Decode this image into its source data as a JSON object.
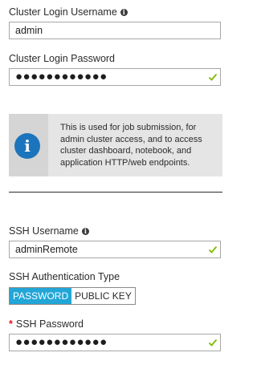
{
  "cluster_login_username": {
    "label": "Cluster Login Username",
    "value": "admin"
  },
  "cluster_login_password": {
    "label": "Cluster Login Password",
    "value": "●●●●●●●●●●●●"
  },
  "info_box": {
    "text": "This is used for job submission, for admin cluster access, and to access cluster dashboard, notebook, and application HTTP/web endpoints."
  },
  "ssh_username": {
    "label": "SSH Username",
    "value": "adminRemote"
  },
  "ssh_auth_type": {
    "label": "SSH Authentication Type",
    "options": [
      "PASSWORD",
      "PUBLIC KEY"
    ],
    "selected": "PASSWORD"
  },
  "ssh_password": {
    "required_marker": "*",
    "label": "SSH Password",
    "value": "●●●●●●●●●●●●"
  },
  "colors": {
    "accent": "#22a6d8",
    "valid_check": "#7fba00",
    "info_icon": "#1c75bc",
    "required": "#e81123"
  },
  "icons": {
    "label_info": "info-circle-icon",
    "valid": "checkmark-icon",
    "info_box": "info-circle-icon"
  }
}
